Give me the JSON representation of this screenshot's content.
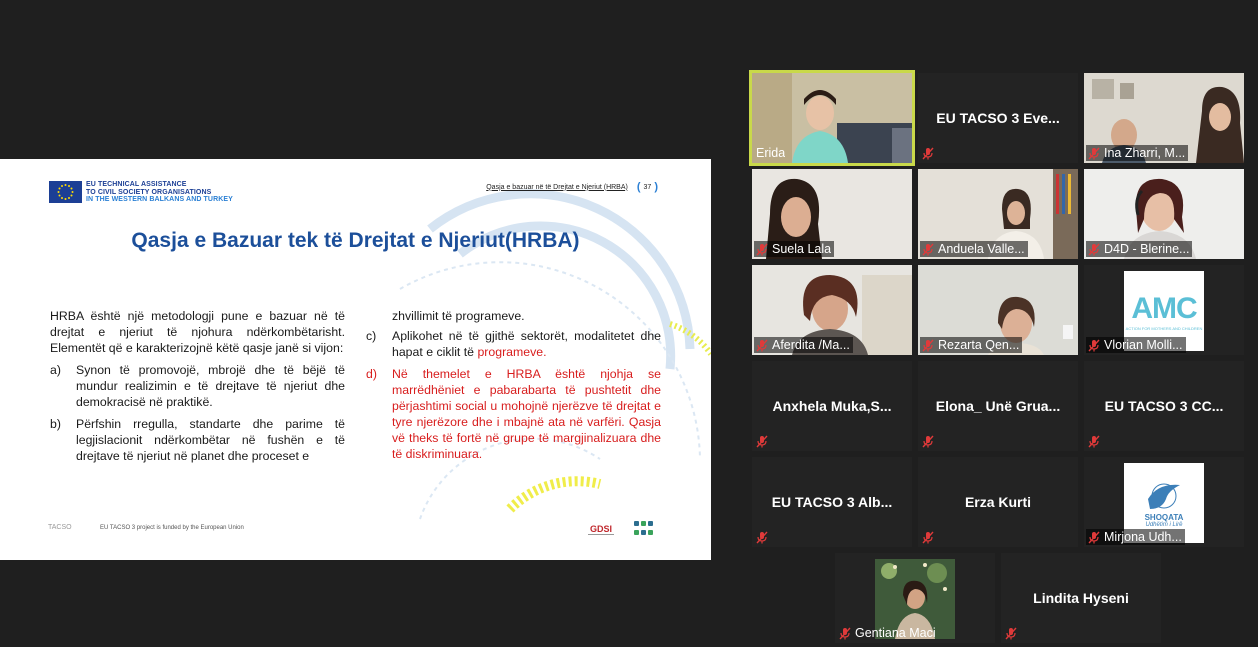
{
  "slide": {
    "eu_logo_lines": [
      "EU TECHNICAL ASSISTANCE",
      "TO CIVIL SOCIETY ORGANISATIONS",
      "IN THE WESTERN BALKANS AND TURKEY"
    ],
    "header_title": "Qasja e bazuar në të Drejtat e Njeriut (HRBA)",
    "slide_number": "37",
    "title": "Qasja e Bazuar tek të Drejtat e Njeriut(HRBA)",
    "left_intro": "HRBA është një metodologji pune e bazuar në të drejtat e njeriut të njohura ndërkombëtarisht. Elementët që e karakterizojnë këtë qasje janë si vijon:",
    "left_items": [
      {
        "marker": "a)",
        "text": "Synon të promovojë, mbrojë dhe të bëjë të mundur realizimin e të drejtave të njeriut dhe demokracisë në praktikë."
      },
      {
        "marker": "b)",
        "text": "Përfshin rregulla, standarte dhe parime të legjislacionit ndërkombëtar në fushën e të drejtave të njeriut në planet dhe proceset e"
      }
    ],
    "right_intro": "zhvillimit të programeve.",
    "right_item_c_marker": "c)",
    "right_item_c_text": "Aplikohet në të gjithë sektorët, modalitetet dhe hapat e ciklit të ",
    "right_item_c_highlight": "programeve.",
    "right_item_d_marker": "d)",
    "right_item_d_text": "Në themelet e HRBA është njohja se marrëdhëniet e pabarabarta të pushtetit dhe përjashtimi social u mohojnë njerëzve të drejtat e tyre njerëzore dhe i mbajnë ata në varfëri. Qasja vë theks të fortë në grupe të margjinalizuara dhe të diskriminuara.",
    "footer_logo": "TACSO",
    "footer_text": "EU TACSO 3 project is funded by the European Union",
    "footer_gdsi": "GDSI",
    "colors": {
      "title_blue": "#1c4f9a",
      "highlight_red": "#d81d1d",
      "active_speaker": "#c9d94a"
    }
  },
  "participants": [
    {
      "name": "Erida",
      "type": "video",
      "active": true,
      "muted": false
    },
    {
      "name": "EU TACSO 3 Eve...",
      "type": "name",
      "muted": true
    },
    {
      "name": "Ina Zharri, M...",
      "type": "video",
      "muted": true
    },
    {
      "name": "Suela Lala",
      "type": "video",
      "muted": true
    },
    {
      "name": "Anduela Valle...",
      "type": "video",
      "muted": true
    },
    {
      "name": "D4D - Blerine...",
      "type": "video",
      "muted": true
    },
    {
      "name": "Aferdita /Ma...",
      "type": "video",
      "muted": true
    },
    {
      "name": "Rezarta Qen...",
      "type": "video",
      "muted": true
    },
    {
      "name": "Vlorian Molli...",
      "type": "picture",
      "picture_text": "AMC",
      "picture_subtext": "ACTION FOR MOTHERS AND CHILDREN",
      "muted": true
    },
    {
      "name": "Anxhela  Muka,S...",
      "type": "name",
      "muted": true
    },
    {
      "name": "Elona_ Unë Grua...",
      "type": "name",
      "muted": true
    },
    {
      "name": "EU TACSO 3 CC...",
      "type": "name",
      "muted": true
    },
    {
      "name": "EU TACSO 3 Alb...",
      "type": "name",
      "muted": true
    },
    {
      "name": "Erza Kurti",
      "type": "name",
      "muted": true
    },
    {
      "name": "Mirjona  Udh...",
      "type": "picture",
      "picture_text": "SHOQATA",
      "picture_subtext": "Udhëtim i Lirë",
      "muted": true
    },
    {
      "name": "Gentiana Maci",
      "type": "picture",
      "muted": true
    },
    {
      "name": "Lindita Hyseni",
      "type": "name",
      "muted": true
    }
  ],
  "icons": {
    "muted_mic": "mic-off-icon"
  }
}
